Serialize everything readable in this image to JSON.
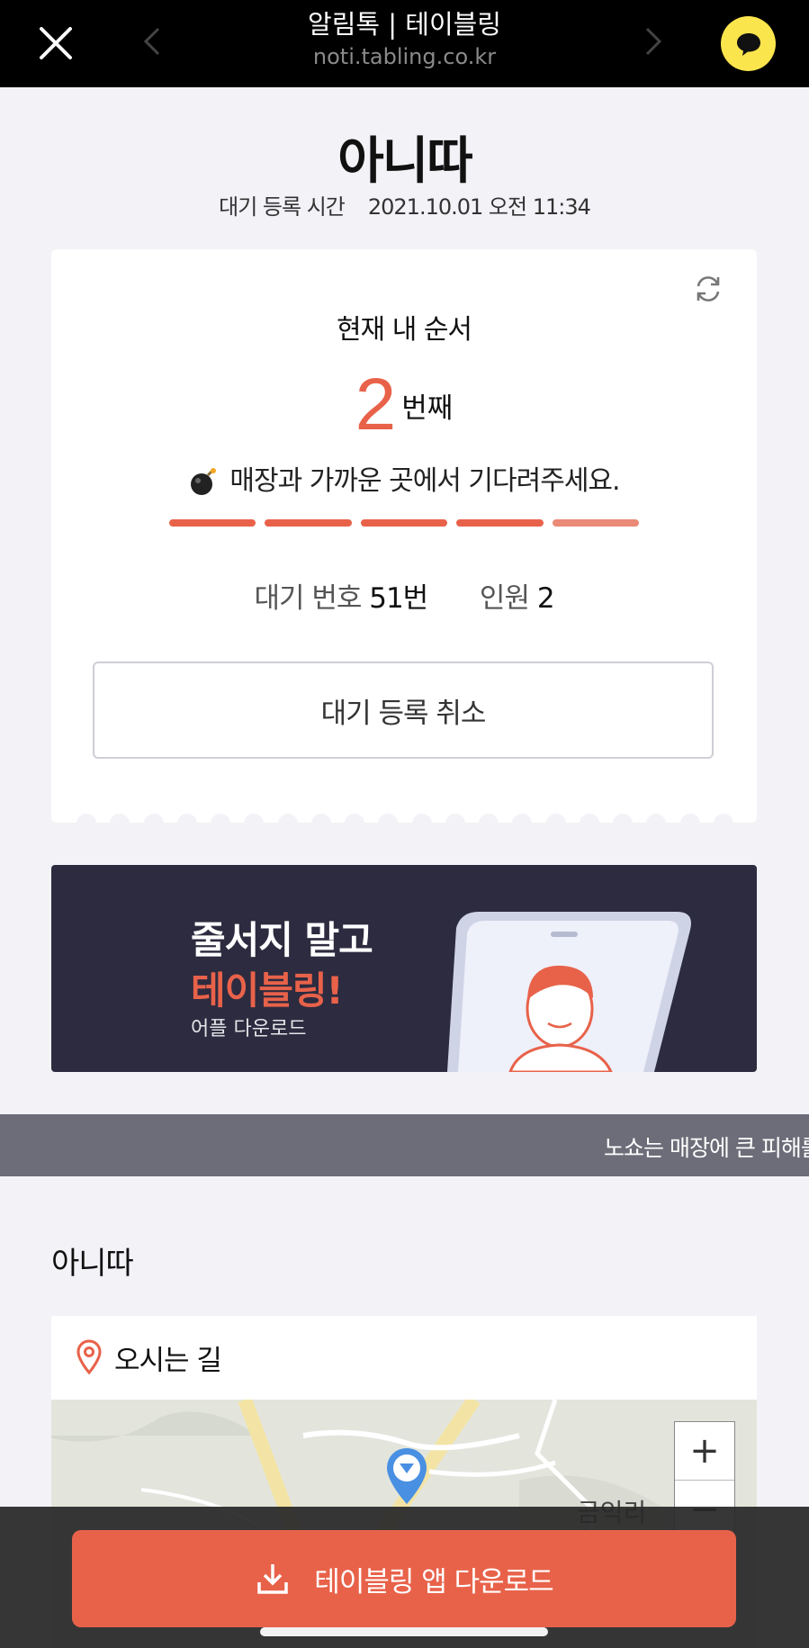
{
  "topbar": {
    "title": "알림톡 | 테이블링",
    "url": "noti.tabling.co.kr"
  },
  "shop": {
    "name": "아니따",
    "reg_label": "대기 등록 시간",
    "reg_time": "2021.10.01 오전 11:34"
  },
  "queue": {
    "current_label": "현재 내 순서",
    "position": "2",
    "position_unit": "번째",
    "message": "매장과 가까운 곳에서 기다려주세요.",
    "progress_segments": 5,
    "wait_number_label": "대기 번호",
    "wait_number": "51번",
    "party_label": "인원",
    "party_size": "2",
    "cancel_label": "대기 등록 취소"
  },
  "banner": {
    "line1": "줄서지 말고",
    "line2": "테이블링!",
    "line3": "어플 다운로드"
  },
  "notice": {
    "text": "노쇼는 매장에 큰 피해를"
  },
  "store": {
    "name": "아니따",
    "directions_label": "오시는 길",
    "map_label": "금익리",
    "zoom_in": "+",
    "zoom_out": "−"
  },
  "download": {
    "label": "테이블링 앱 다운로드"
  },
  "colors": {
    "accent": "#e8624a",
    "kakao_yellow": "#fbe54d",
    "banner_bg": "#2d2b3f"
  }
}
